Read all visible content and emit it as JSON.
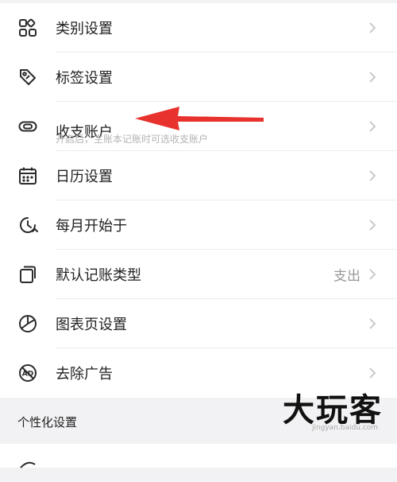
{
  "settings": {
    "items": [
      {
        "id": "category",
        "label": "类别设置",
        "icon": "category-grid-icon"
      },
      {
        "id": "tag",
        "label": "标签设置",
        "icon": "tag-icon"
      },
      {
        "id": "account",
        "label": "收支账户",
        "subtitle": "开启后，主账本记账时可选收支账户",
        "icon": "link-icon"
      },
      {
        "id": "calendar",
        "label": "日历设置",
        "icon": "calendar-icon"
      },
      {
        "id": "month-start",
        "label": "每月开始于",
        "icon": "clock-icon"
      },
      {
        "id": "default-type",
        "label": "默认记账类型",
        "value": "支出",
        "icon": "copy-icon"
      },
      {
        "id": "chart-page",
        "label": "图表页设置",
        "icon": "pie-chart-icon"
      },
      {
        "id": "remove-ads",
        "label": "去除广告",
        "icon": "ad-icon"
      }
    ]
  },
  "section": {
    "title": "个性化设置"
  },
  "watermark": {
    "main": "大玩客",
    "sub": "jingyan.baidu.com"
  },
  "colors": {
    "arrow": "#e8322d",
    "chevron": "#c4c4c4",
    "icon": "#2b2b2b"
  }
}
